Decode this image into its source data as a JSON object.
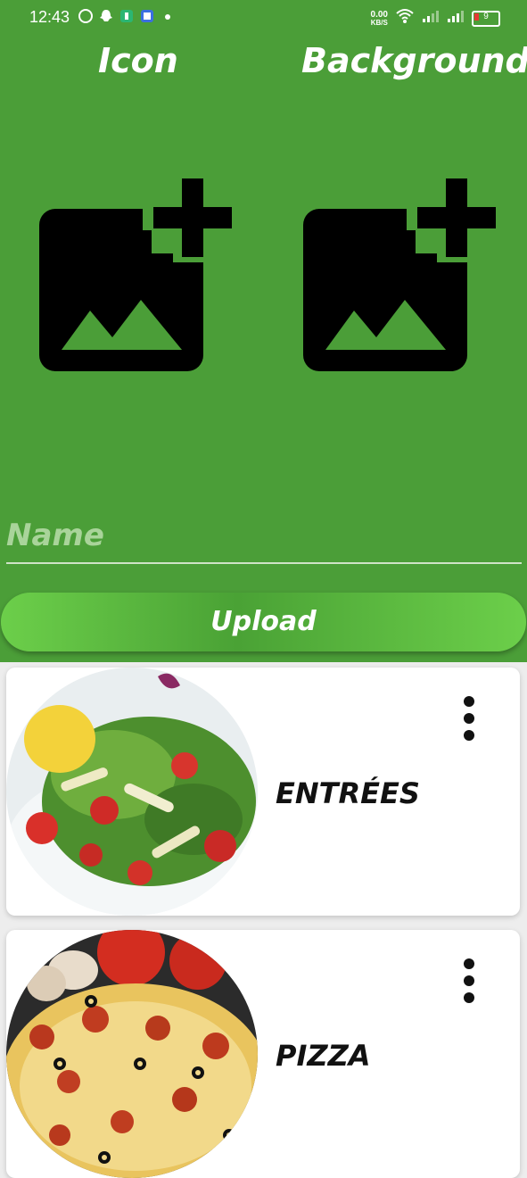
{
  "status_bar": {
    "time": "12:43",
    "net_speed_value": "0.00",
    "net_speed_unit": "KB/S",
    "battery": "9"
  },
  "header": {
    "icon_label": "Icon",
    "background_label": "Background"
  },
  "form": {
    "name_placeholder": "Name",
    "name_value": "",
    "upload_label": "Upload"
  },
  "categories": [
    {
      "label": "ENTRÉES",
      "image": "salad-photo"
    },
    {
      "label": "PIZZA",
      "image": "pizza-photo"
    }
  ],
  "colors": {
    "primary_green": "#4b9e38",
    "button_green": "#6ccf4a",
    "card_bg": "#ffffff"
  }
}
